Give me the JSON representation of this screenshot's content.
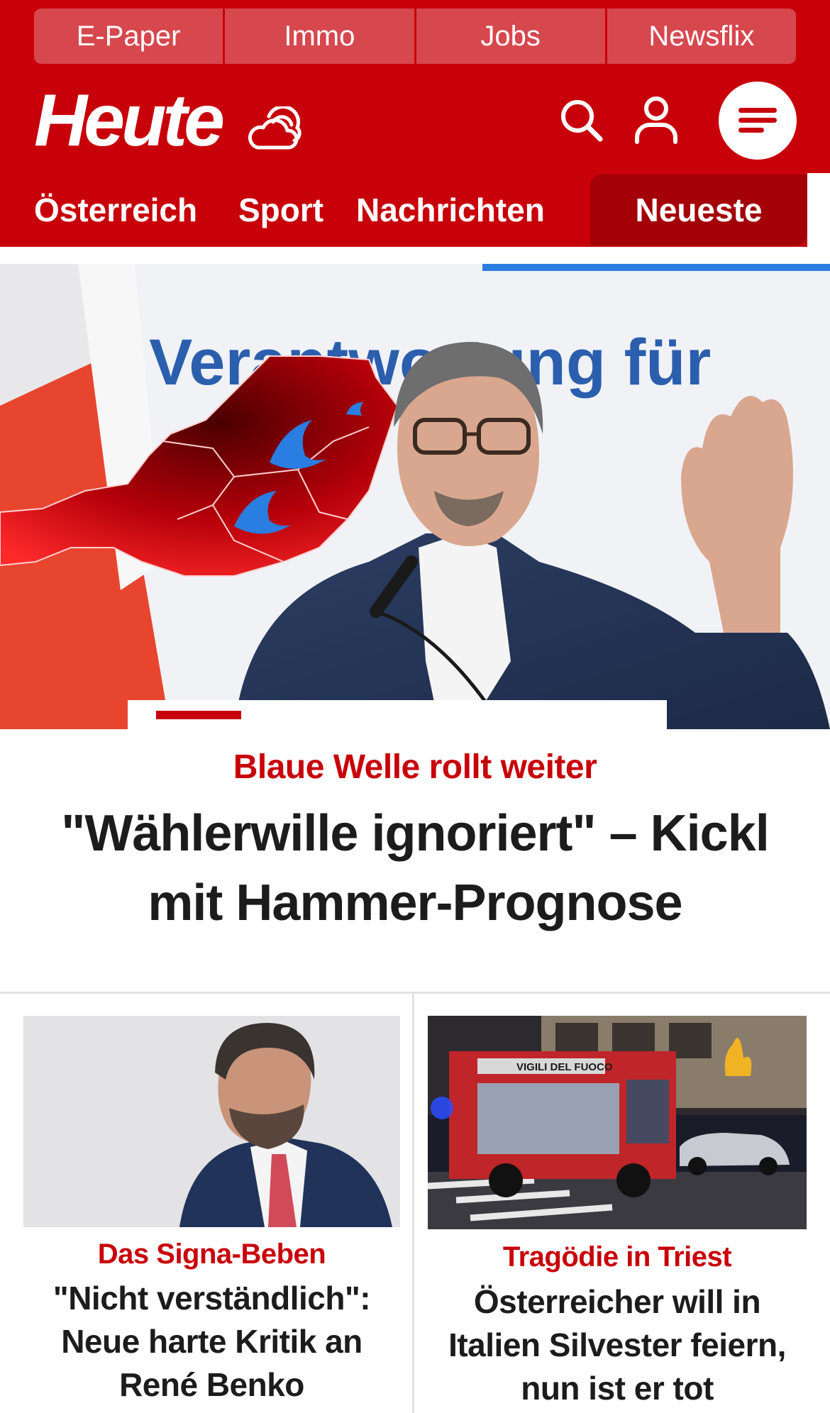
{
  "utility_nav": [
    {
      "label": "E-Paper"
    },
    {
      "label": "Immo"
    },
    {
      "label": "Jobs"
    },
    {
      "label": "Newsflix"
    }
  ],
  "brand": {
    "logo_text": "Heute"
  },
  "section_nav": {
    "items": [
      {
        "label": "Österreich"
      },
      {
        "label": "Sport"
      },
      {
        "label": "Nachrichten"
      }
    ],
    "active": {
      "label": "Neueste"
    }
  },
  "hero": {
    "kicker": "Blaue Welle rollt weiter",
    "headline": "\"Wählerwille ignoriert\" – Kickl mit Hammer-Prognose",
    "backdrop_text": "Verantwortung für"
  },
  "cards": [
    {
      "kicker": "Das Signa-Beben",
      "headline": "\"Nicht verständlich\": Neue harte Kritik an René Benko"
    },
    {
      "kicker": "Tragödie in Triest",
      "headline": "Österreicher will in Italien Silvester feiern, nun ist er tot",
      "truck_text": "VIGILI DEL FUOCO"
    }
  ],
  "icons": {
    "weather": "cloud-sun-icon",
    "search": "search-icon",
    "user": "user-icon",
    "menu": "menu-icon"
  },
  "colors": {
    "brand_red": "#c8000a",
    "active_tab": "#a30008",
    "headline_text": "#1c1c1c"
  }
}
